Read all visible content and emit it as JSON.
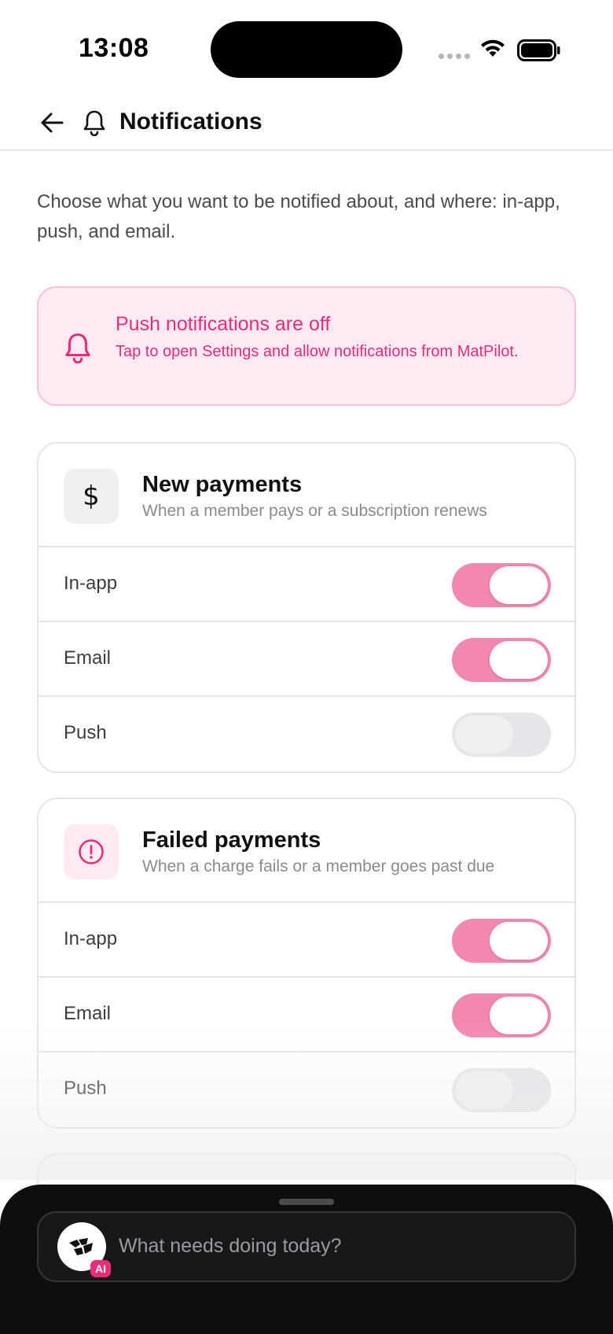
{
  "status_bar": {
    "time": "13:08"
  },
  "navbar": {
    "title": "Notifications"
  },
  "intro": "Choose what you want to be notified about, and where: in-app, push, and email.",
  "banner": {
    "title": "Push notifications are off",
    "text": "Tap to open Settings and allow notifications from MatPilot.",
    "color": "#ea2b78"
  },
  "cards": [
    {
      "title": "New payments",
      "subtitle": "When a member pays or a subscription renews",
      "icon": "dollar-icon",
      "rows": [
        {
          "label": "In-app",
          "enabled": true
        },
        {
          "label": "Email",
          "enabled": true
        },
        {
          "label": "Push",
          "enabled": false
        }
      ]
    },
    {
      "title": "Failed payments",
      "subtitle": "When a charge fails or a member goes past due",
      "icon": "alert-circle-icon",
      "rows": [
        {
          "label": "In-app",
          "enabled": true
        },
        {
          "label": "Email",
          "enabled": true
        },
        {
          "label": "Push",
          "enabled": false
        }
      ]
    }
  ],
  "assistant": {
    "placeholder": "What needs doing today?",
    "badge": "AI"
  },
  "colors": {
    "accent": "#ea2b78",
    "toggle_on": "#f288b2",
    "toggle_off": "#e6e6ea"
  }
}
